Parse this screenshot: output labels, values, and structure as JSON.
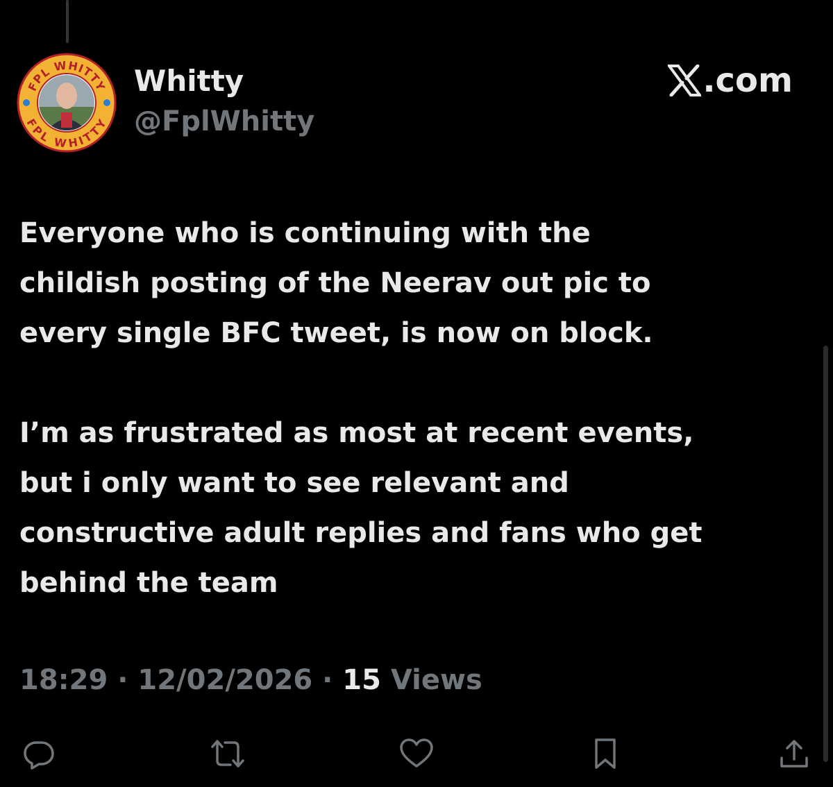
{
  "author": {
    "name": "Whitty",
    "handle": "@FplWhitty",
    "avatar_text_top": "FPL WHITTY",
    "avatar_text_bottom": "FPL WHITTY"
  },
  "brand": {
    "text": ".com",
    "icon": "x-logo-icon"
  },
  "tweet": {
    "paragraphs": [
      "Everyone who is continuing with the\nchildish posting of the Neerav out pic to\nevery single BFC tweet, is now on block.",
      "I’m as frustrated as most at recent events,\nbut i only want to see relevant and\nconstructive adult replies and fans who get\nbehind the team"
    ]
  },
  "meta": {
    "time": "18:29",
    "separator": " · ",
    "date": "12/02/2026",
    "views_count": "15",
    "views_label": " Views"
  },
  "actions": [
    {
      "name": "reply",
      "icon": "reply-icon"
    },
    {
      "name": "repost",
      "icon": "repost-icon"
    },
    {
      "name": "like",
      "icon": "heart-icon"
    },
    {
      "name": "bookmark",
      "icon": "bookmark-icon"
    },
    {
      "name": "share",
      "icon": "share-icon"
    }
  ],
  "colors": {
    "background": "#000000",
    "text_primary": "#e7e9ea",
    "text_secondary": "#71767b",
    "avatar_ring": "#f2b233",
    "avatar_ring_text": "#b3202a"
  }
}
